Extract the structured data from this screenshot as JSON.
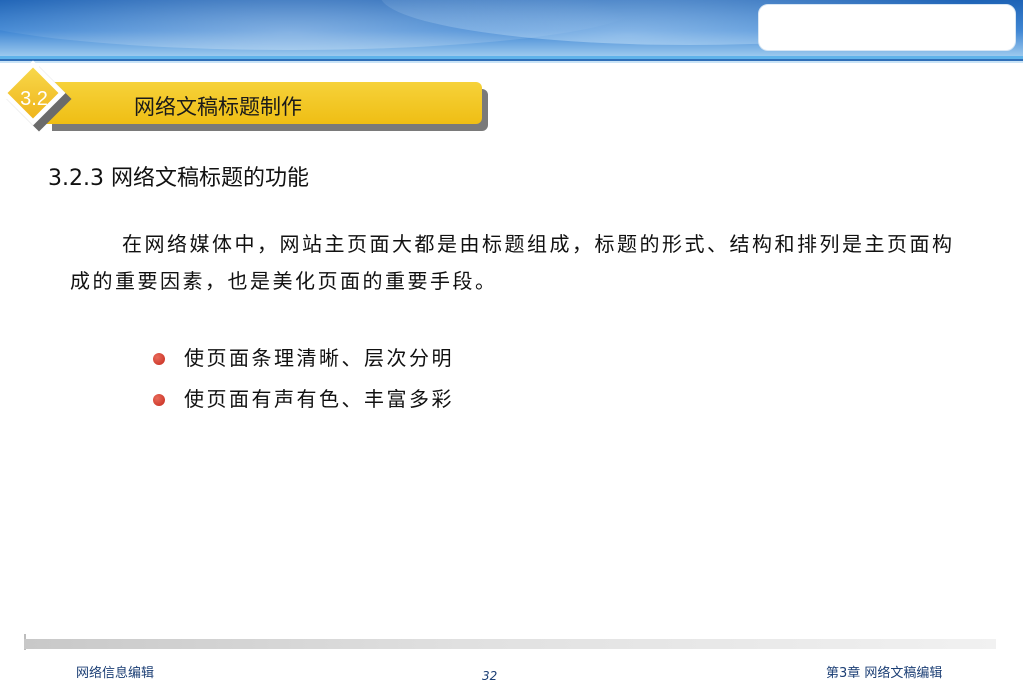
{
  "slide": {
    "section_number": "3.2",
    "section_title": "网络文稿标题制作",
    "subheading": "3.2.3 网络文稿标题的功能",
    "paragraph": "在网络媒体中，网站主页面大都是由标题组成，标题的形式、结构和排列是主页面构成的重要因素，也是美化页面的重要手段。",
    "bullets": [
      {
        "text": "使页面条理清晰、层次分明"
      },
      {
        "text": "使页面有声有色、丰富多彩"
      }
    ]
  },
  "footer": {
    "course_name": "网络信息编辑",
    "page_number": "32",
    "chapter_title": "第3章 网络文稿编辑"
  },
  "colors": {
    "header_blue": "#2f6fb8",
    "title_yellow": "#efbe14",
    "bullet_red": "#c62a1d",
    "footer_text": "#1c3f75"
  }
}
